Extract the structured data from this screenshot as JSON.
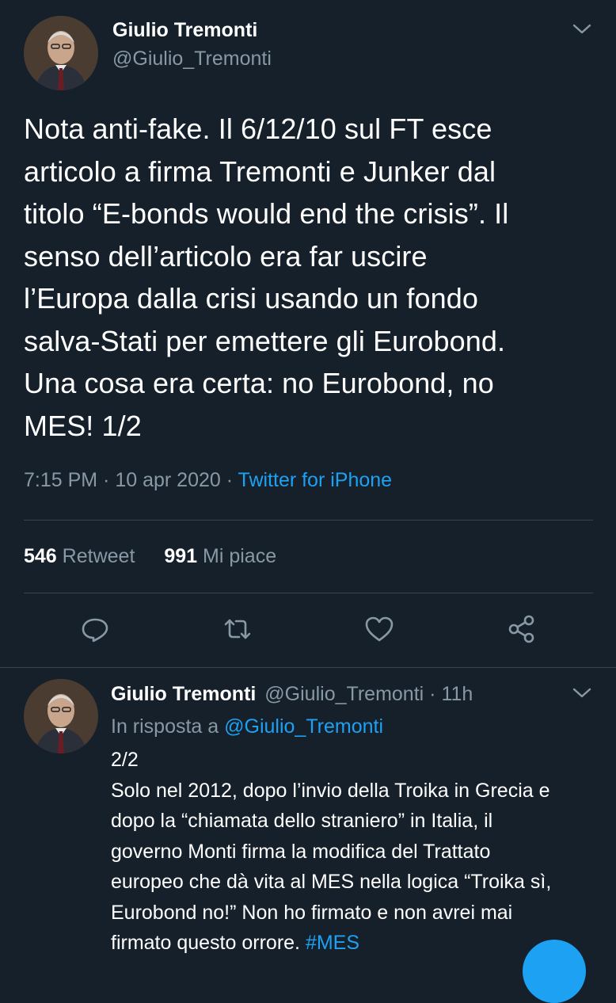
{
  "tweet": {
    "author_name": "Giulio Tremonti",
    "author_handle": "@Giulio_Tremonti",
    "text_lines": [
      "Nota anti-fake. Il 6/12/10 sul FT esce",
      "articolo a firma Tremonti e Junker dal",
      "titolo “E-bonds would end the crisis”. Il",
      "senso dell’articolo era far uscire",
      "l’Europa dalla crisi usando un fondo",
      "salva-Stati per emettere gli Eurobond.",
      "Una cosa era certa: no Eurobond, no",
      "MES! 1/2"
    ],
    "time": "7:15 PM",
    "dot": " · ",
    "date": "10 apr 2020",
    "source": "Twitter for iPhone",
    "retweets_count": "546",
    "retweets_label": "Retweet",
    "likes_count": "991",
    "likes_label": "Mi piace"
  },
  "actions": [
    "reply-icon",
    "retweet-icon",
    "like-icon",
    "share-icon"
  ],
  "reply": {
    "author_name": "Giulio Tremonti",
    "author_handle": "@Giulio_Tremonti",
    "age": "11h",
    "in_reply_prefix": "In risposta a",
    "in_reply_handle": "@Giulio_Tremonti",
    "text_lines": [
      "2/2",
      "Solo nel 2012, dopo l’invio della Troika in Grecia e",
      "dopo la “chiamata dello straniero” in Italia, il",
      "governo Monti firma la modifica del Trattato",
      "europeo che dà vita al MES nella logica “Troika sì,",
      "Eurobond no!” Non ho firmato e non avrei mai"
    ],
    "last_line_text": "firmato questo orrore.",
    "hashtag": "#MES"
  },
  "colors": {
    "background": "#15202b",
    "text": "#ffffff",
    "secondary": "#8899a6",
    "accent": "#1da1f2",
    "divider": "#38444d"
  }
}
